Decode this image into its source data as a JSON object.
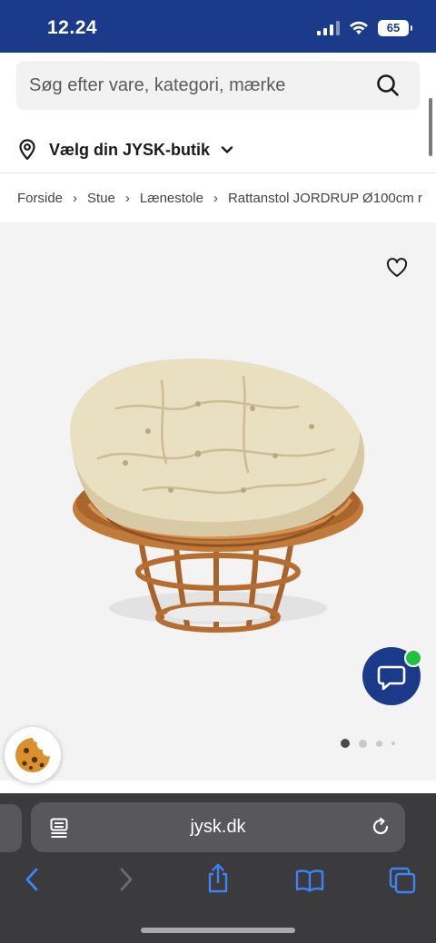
{
  "status_bar": {
    "time": "12.24",
    "battery": "65"
  },
  "search": {
    "placeholder": "Søg efter vare, kategori, mærke"
  },
  "store_selector": {
    "label": "Vælg din JYSK-butik"
  },
  "breadcrumb": [
    "Forside",
    "Stue",
    "Lænestole",
    "Rattanstol JORDRUP Ø100cm r"
  ],
  "product": {
    "carousel": {
      "total": 4,
      "active_index": 0
    }
  },
  "browser": {
    "url": "jysk.dk"
  },
  "colors": {
    "brand_blue": "#1c3a8a",
    "online_green": "#20c040",
    "toolbar_blue": "#3d82f6"
  },
  "icons": [
    "search-icon",
    "location-pin-icon",
    "chevron-down-icon",
    "heart-icon",
    "chat-icon",
    "cookie-icon",
    "reader-icon",
    "reload-icon",
    "back-icon",
    "forward-icon",
    "share-icon",
    "bookmarks-icon",
    "tabs-icon"
  ]
}
